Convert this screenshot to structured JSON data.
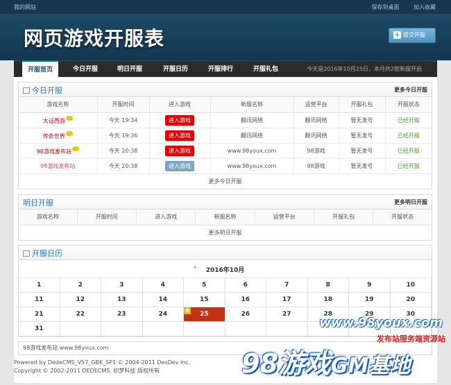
{
  "topbar": {
    "site": "我的网站",
    "save_desktop": "保存到桌面",
    "favorite": "加入收藏"
  },
  "header": {
    "logo": "网页游戏开服表",
    "submit_button": "提交开服"
  },
  "nav": {
    "items": [
      "开服首页",
      "今日开服",
      "明日开服",
      "开服日历",
      "开服排行",
      "开服礼包"
    ],
    "date_text": "今天是2016年10月25日，本月共2款新服开启"
  },
  "today": {
    "title": "今日开服",
    "more": "更多今日开服",
    "columns": [
      "游戏名称",
      "开服时间",
      "进入游戏",
      "新服名称",
      "运营平台",
      "开服礼包",
      "开服状态"
    ],
    "rows": [
      {
        "name": "大话西游",
        "time": "今天 19:34",
        "enter": "进入游戏",
        "server": "翻讯网络",
        "platform": "翻讯网络",
        "gift": "暂无发号",
        "status": "已经开服"
      },
      {
        "name": "传奇世界",
        "time": "今天 19:36",
        "enter": "进入游戏",
        "server": "翻讯网络",
        "platform": "翻讯网络",
        "gift": "暂无发号",
        "status": "已经开服"
      },
      {
        "name": "98游戏发布站",
        "time": "今天 20:38",
        "enter": "进入游戏",
        "server": "www.98youx.com",
        "platform": "98游戏",
        "gift": "暂无发号",
        "status": "已经开服"
      },
      {
        "name": "98游戏发布站",
        "time": "今天 20:38",
        "enter": "进入游戏",
        "server": "www.98youx.com",
        "platform": "98游戏",
        "gift": "暂无发号",
        "status": "已经开服"
      }
    ],
    "more_row": "更多今日开服"
  },
  "tomorrow": {
    "title": "明日开服",
    "more": "更多明日开服",
    "columns": [
      "游戏名称",
      "开服时间",
      "进入游戏",
      "新服名称",
      "运营平台",
      "开服礼包",
      "开服状态"
    ],
    "more_row": "更多明日开服"
  },
  "calendar": {
    "title": "开服日历",
    "prev": "‹",
    "month": "2016年10月",
    "today_mark": "今",
    "weeks": [
      [
        "1",
        "2",
        "3",
        "4",
        "5",
        "6",
        "7",
        "8",
        "9",
        "10"
      ],
      [
        "11",
        "12",
        "13",
        "14",
        "15",
        "16",
        "17",
        "18",
        "19",
        "20"
      ],
      [
        "21",
        "22",
        "23",
        "24",
        "25",
        "26",
        "27",
        "28",
        "29",
        "30"
      ],
      [
        "31",
        "",
        "",
        "",
        "",
        "",
        "",
        "",
        "",
        ""
      ]
    ],
    "today": "25"
  },
  "footer": {
    "links": "98游戏发布站  www.98youx.com",
    "powered": "Powered by DedeCMS_V57_GBK_SP1 © 2004-2011 DesDev Inc.",
    "copyright": "Copyright © 2002-2011 DEDECMS. 织梦科技 版权所有"
  },
  "watermark": {
    "url": "www.98youx.com",
    "tag": "发布站服务端资源站",
    "big": "98游戏",
    "big_suffix": "GM基地"
  },
  "colors": {
    "header": "#14374f",
    "accent": "#2c76b8",
    "red": "#e80000",
    "green": "#4aa02c",
    "today": "#c43213"
  },
  "icons": [
    "plus-icon",
    "calendar-icon",
    "list-icon",
    "new-badge-icon"
  ]
}
